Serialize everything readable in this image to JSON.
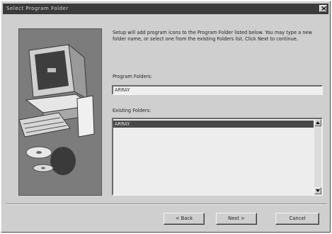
{
  "window": {
    "title": "Select Program Folder",
    "close_icon": "close-icon"
  },
  "description": "Setup will add program icons to the Program Folder listed below. You may type a new folder name, or select one from the existing Folders list.  Click Next to continue.",
  "program_folder": {
    "label": "Program Folders:",
    "value": "ARRAY"
  },
  "existing_folders": {
    "label": "Existing Folders:",
    "items": [
      "ARRAY"
    ]
  },
  "buttons": {
    "back": "< Back",
    "next": "Next >",
    "cancel": "Cancel"
  },
  "colors": {
    "dialog": "#cfcfcf",
    "titlebar": "#3b3b3b",
    "selection": "#484848",
    "art_panel": "#7a7a7a"
  }
}
